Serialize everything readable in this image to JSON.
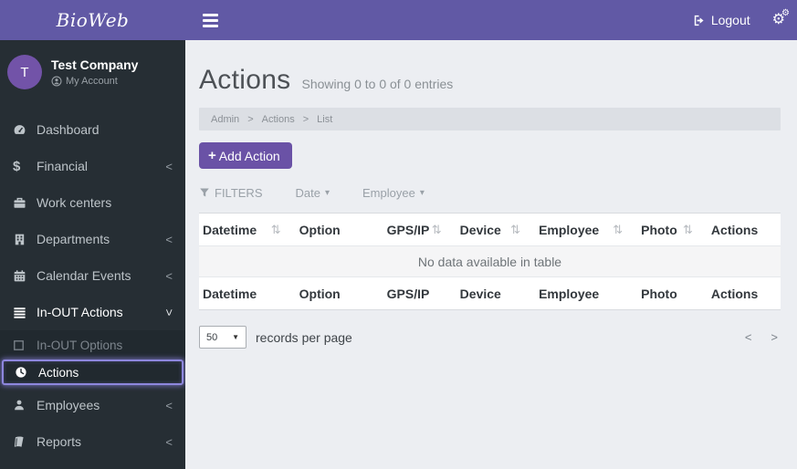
{
  "colors": {
    "header_purple": "#6159a5",
    "button_purple": "#6a52a6",
    "sidebar_bg": "#262e34",
    "submenu_bg": "#21292f",
    "content_bg": "#eceef2",
    "active_ring_purple": "#8d86dd",
    "avatar_purple": "#7253a8"
  },
  "header": {
    "brand": "BioWeb",
    "logout_label": "Logout",
    "gears_glyph": "⚙"
  },
  "sidebar": {
    "user": {
      "initial": "T",
      "name": "Test Company",
      "account_label": "My Account"
    },
    "items": [
      {
        "label": "Dashboard"
      },
      {
        "label": "Financial"
      },
      {
        "label": "Work centers"
      },
      {
        "label": "Departments"
      },
      {
        "label": "Calendar Events"
      },
      {
        "label": "In-OUT Actions"
      },
      {
        "label": "Employees"
      },
      {
        "label": "Reports"
      }
    ],
    "subitems": [
      {
        "label": "In-OUT Options"
      },
      {
        "label": "Actions"
      }
    ]
  },
  "main": {
    "title": "Actions",
    "subtitle": "Showing 0 to 0 of 0 entries",
    "breadcrumb": {
      "items": [
        "Admin",
        "Actions",
        "List"
      ],
      "separator": ">"
    },
    "add_button": {
      "plus": "+",
      "label": "Add Action"
    },
    "filters": {
      "label": "FILTERS",
      "date": "Date",
      "employee": "Employee"
    }
  },
  "table": {
    "sort_glyph": "⇅",
    "columns": [
      "Datetime",
      "Option",
      "GPS/IP",
      "Device",
      "Employee",
      "Photo",
      "Actions"
    ],
    "empty_text": "No data available in table"
  },
  "pagination": {
    "records_value": "50",
    "records_label": "records per page",
    "prev": "<",
    "next": ">"
  }
}
